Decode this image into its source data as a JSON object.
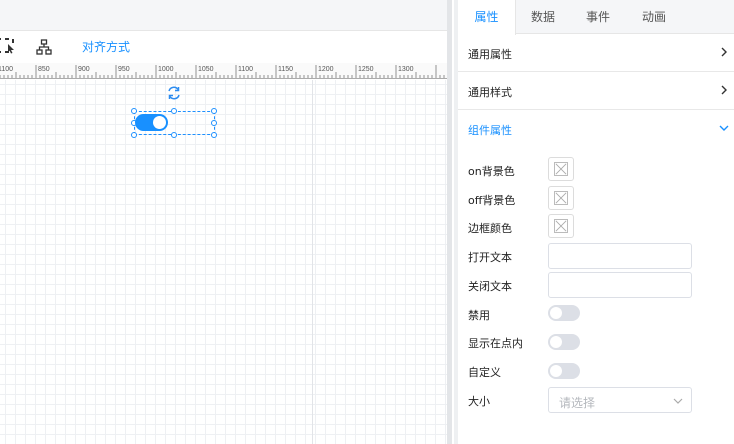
{
  "toolbar": {
    "align_label": "对齐方式"
  },
  "ruler": {
    "ticks": [
      "1100",
      "850",
      "900",
      "950",
      "1000",
      "1050",
      "1100",
      "1150",
      "1200",
      "1250",
      "1300"
    ]
  },
  "panel": {
    "tabs": [
      {
        "label": "属性",
        "active": true
      },
      {
        "label": "数据",
        "active": false
      },
      {
        "label": "事件",
        "active": false
      },
      {
        "label": "动画",
        "active": false
      }
    ],
    "sections": [
      {
        "label": "通用属性",
        "expanded": false
      },
      {
        "label": "通用样式",
        "expanded": false
      },
      {
        "label": "组件属性",
        "expanded": true
      }
    ],
    "props": {
      "on_bg": "on背景色",
      "off_bg": "off背景色",
      "border_color": "边框颜色",
      "open_text": "打开文本",
      "open_text_value": "",
      "close_text": "关闭文本",
      "close_text_value": "",
      "disabled": "禁用",
      "show_inside": "显示在点内",
      "custom": "自定义",
      "size": "大小",
      "size_placeholder": "请选择"
    }
  },
  "colors": {
    "accent": "#1890ff",
    "switch_on": "#1890ff",
    "toggle_off": "#dcdfe6"
  }
}
